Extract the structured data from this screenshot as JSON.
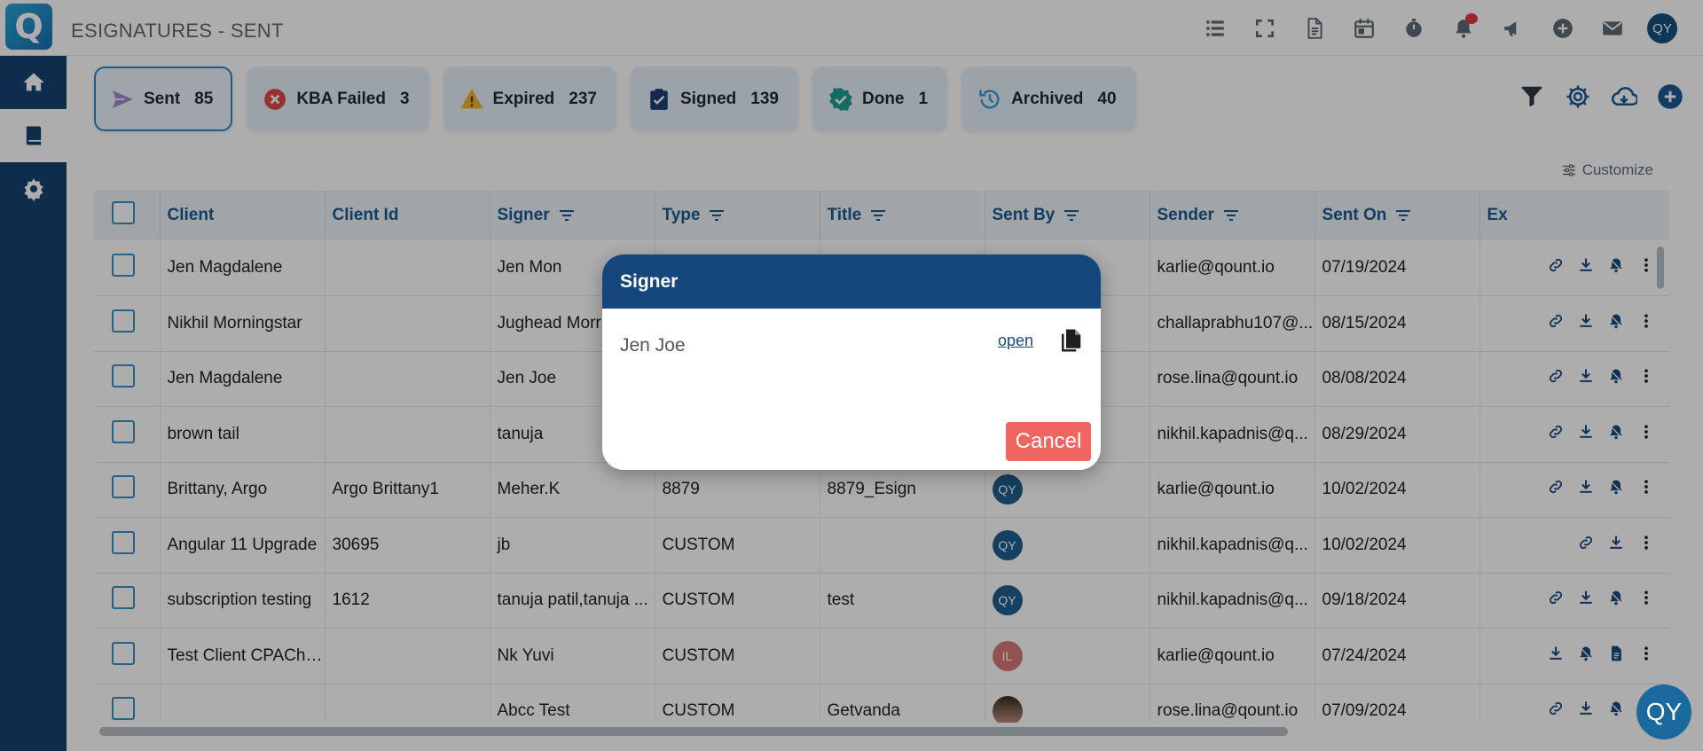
{
  "app": {
    "logo_letter": "Q",
    "title": "ESIGNATURES - SENT"
  },
  "header": {
    "icons": [
      "list-icon",
      "fullscreen-icon",
      "document-icon",
      "calendar-icon",
      "timer-icon",
      "bell-icon",
      "megaphone-icon",
      "plus-circle-icon",
      "mail-icon"
    ],
    "user_initials": "QY"
  },
  "sidebar": {
    "items": [
      "home-icon",
      "book-icon",
      "settings-icon"
    ]
  },
  "tabs": [
    {
      "label": "Sent",
      "count": "85",
      "icon": "send-icon",
      "color": "#8e7fc9"
    },
    {
      "label": "KBA Failed",
      "count": "3",
      "icon": "error-icon",
      "color": "#e04b4b"
    },
    {
      "label": "Expired",
      "count": "237",
      "icon": "warning-icon",
      "color": "#f2b233"
    },
    {
      "label": "Signed",
      "count": "139",
      "icon": "clipboard-check-icon",
      "color": "#1d3f73"
    },
    {
      "label": "Done",
      "count": "1",
      "icon": "verified-icon",
      "color": "#1c9e8f"
    },
    {
      "label": "Archived",
      "count": "40",
      "icon": "history-icon",
      "color": "#3ba0dd"
    }
  ],
  "toolbar": {
    "customize_label": "Customize"
  },
  "table": {
    "headers": [
      "Client",
      "Client Id",
      "Signer",
      "Type",
      "Title",
      "Sent By",
      "Sender",
      "Sent On",
      "Ex"
    ],
    "rows": [
      {
        "client": "Jen Magdalene",
        "client_id": "",
        "signer": "Jen Mon",
        "type": "",
        "title": "",
        "sent_by": "",
        "sender": "karlie@qount.io",
        "sent_on": "07/19/2024"
      },
      {
        "client": "Nikhil Morningstar",
        "client_id": "",
        "signer": "Jughead Morr",
        "type": "",
        "title": "",
        "sent_by": "",
        "sender": "challaprabhu107@...",
        "sent_on": "08/15/2024"
      },
      {
        "client": "Jen Magdalene",
        "client_id": "",
        "signer": "Jen Joe",
        "type": "",
        "title": "",
        "sent_by": "",
        "sender": "rose.lina@qount.io",
        "sent_on": "08/08/2024"
      },
      {
        "client": "brown tail",
        "client_id": "",
        "signer": "tanuja",
        "type": "",
        "title": "",
        "sent_by": "",
        "sender": "nikhil.kapadnis@q...",
        "sent_on": "08/29/2024"
      },
      {
        "client": "Brittany, Argo",
        "client_id": "Argo Brittany1",
        "signer": "Meher.K",
        "type": "8879",
        "title": "8879_Esign",
        "sent_by": "QY",
        "sender": "karlie@qount.io",
        "sent_on": "10/02/2024"
      },
      {
        "client": "Angular 11 Upgrade",
        "client_id": "30695",
        "signer": "jb",
        "type": "CUSTOM",
        "title": "",
        "sent_by": "QY",
        "sender": "nikhil.kapadnis@q...",
        "sent_on": "10/02/2024"
      },
      {
        "client": "subscription testing",
        "client_id": "1612",
        "signer": "tanuja patil,tanuja ...",
        "type": "CUSTOM",
        "title": "test",
        "sent_by": "QY",
        "sender": "nikhil.kapadnis@q...",
        "sent_on": "09/18/2024"
      },
      {
        "client": "Test Client CPACharg",
        "client_id": "",
        "signer": "Nk Yuvi",
        "type": "CUSTOM",
        "title": "",
        "sent_by": "IL",
        "sender": "karlie@qount.io",
        "sent_on": "07/24/2024"
      },
      {
        "client": "",
        "client_id": "",
        "signer": "Abcc Test",
        "type": "CUSTOM",
        "title": "Getvanda",
        "sent_by": "",
        "sender": "rose.lina@qount.io",
        "sent_on": "07/09/2024"
      }
    ]
  },
  "modal": {
    "title": "Signer",
    "signer_name": "Jen Joe",
    "open_label": "open",
    "cancel_label": "Cancel"
  },
  "chat": {
    "label": "QY"
  }
}
